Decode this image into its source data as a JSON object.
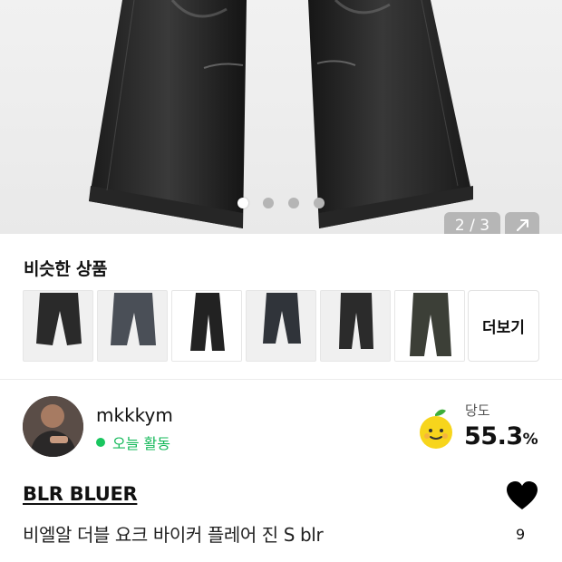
{
  "gallery": {
    "counter": "2 / 3",
    "dots": [
      true,
      false,
      false,
      false
    ],
    "expand_icon": "expand-arrow-icon"
  },
  "similar": {
    "title": "비슷한 상품",
    "more_label": "더보기",
    "thumbnails": [
      {
        "alt": "black-wide-jeans"
      },
      {
        "alt": "grey-wide-jeans"
      },
      {
        "alt": "black-flare-jeans"
      },
      {
        "alt": "dark-straight-jeans"
      },
      {
        "alt": "black-cargo-jeans"
      },
      {
        "alt": "washed-black-jeans"
      }
    ]
  },
  "seller": {
    "name": "mkkkym",
    "status": "오늘 활동",
    "status_color": "#14b95a",
    "sugar_label": "당도",
    "sugar_value": "55.3",
    "sugar_unit": "%"
  },
  "product": {
    "brand": "BLR BLUER",
    "title": "비엘알 더블 요크 바이커 플레어 진 S blr",
    "likes": "9"
  }
}
